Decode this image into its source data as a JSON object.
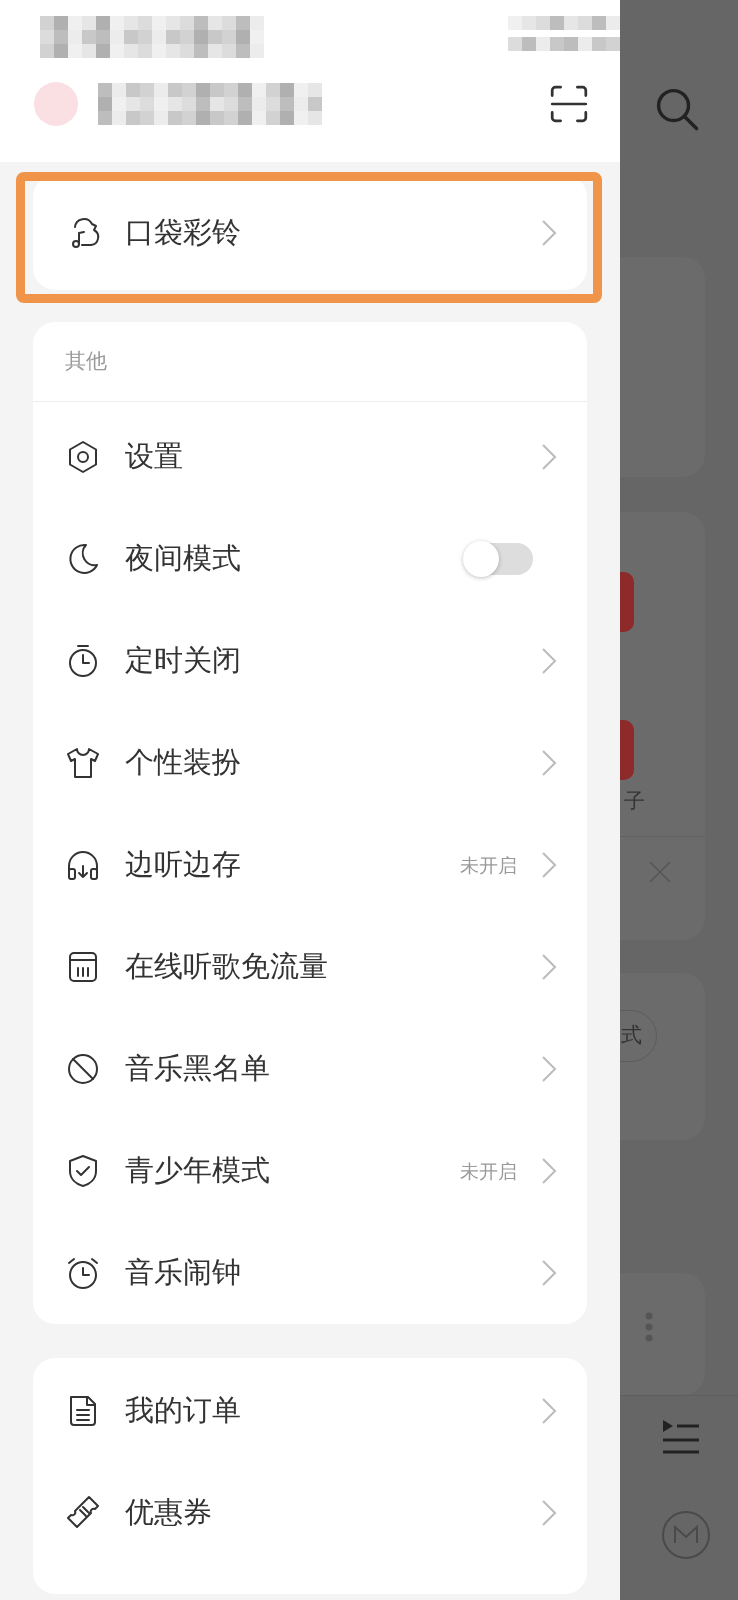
{
  "featured_item": {
    "label": "口袋彩铃",
    "highlighted": true
  },
  "other_section": {
    "title": "其他",
    "items": [
      {
        "kind": "link",
        "label": "设置"
      },
      {
        "kind": "toggle",
        "label": "夜间模式",
        "on": false
      },
      {
        "kind": "link",
        "label": "定时关闭"
      },
      {
        "kind": "link",
        "label": "个性装扮"
      },
      {
        "kind": "link",
        "label": "边听边存",
        "status": "未开启"
      },
      {
        "kind": "link",
        "label": "在线听歌免流量"
      },
      {
        "kind": "link",
        "label": "音乐黑名单"
      },
      {
        "kind": "link",
        "label": "青少年模式",
        "status": "未开启"
      },
      {
        "kind": "link",
        "label": "音乐闹钟"
      }
    ]
  },
  "shop_section": {
    "items": [
      {
        "kind": "link",
        "label": "我的订单"
      },
      {
        "kind": "link",
        "label": "优惠券"
      }
    ]
  },
  "background_page": {
    "texts": [
      "子",
      "式"
    ]
  }
}
